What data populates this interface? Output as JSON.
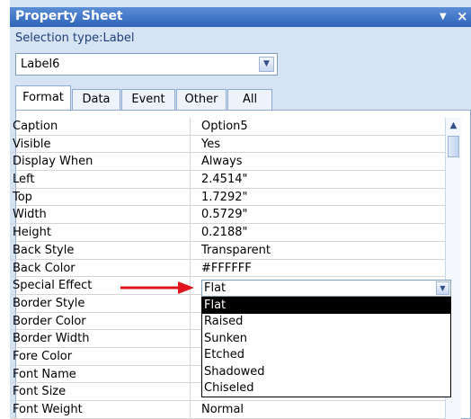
{
  "window": {
    "title": "Property Sheet",
    "menu_icon": "dropdown-arrow-icon",
    "close_icon": "close-icon"
  },
  "selection": {
    "type_label": "Selection type:Label",
    "selected_object": "Label6"
  },
  "tabs": [
    {
      "label": "Format",
      "active": true
    },
    {
      "label": "Data",
      "active": false
    },
    {
      "label": "Event",
      "active": false
    },
    {
      "label": "Other",
      "active": false
    },
    {
      "label": "All",
      "active": false
    }
  ],
  "properties": [
    {
      "name": "Caption",
      "value": "Option5"
    },
    {
      "name": "Visible",
      "value": "Yes"
    },
    {
      "name": "Display When",
      "value": "Always"
    },
    {
      "name": "Left",
      "value": "2.4514\""
    },
    {
      "name": "Top",
      "value": "1.7292\""
    },
    {
      "name": "Width",
      "value": "0.5729\""
    },
    {
      "name": "Height",
      "value": "0.2188\""
    },
    {
      "name": "Back Style",
      "value": "Transparent"
    },
    {
      "name": "Back Color",
      "value": "#FFFFFF"
    },
    {
      "name": "Special Effect",
      "value": ""
    },
    {
      "name": "Border Style",
      "value": ""
    },
    {
      "name": "Border Color",
      "value": ""
    },
    {
      "name": "Border Width",
      "value": ""
    },
    {
      "name": "Fore Color",
      "value": ""
    },
    {
      "name": "Font Name",
      "value": ""
    },
    {
      "name": "Font Size",
      "value": ""
    },
    {
      "name": "Font Weight",
      "value": "Normal"
    }
  ],
  "special_effect": {
    "current": "Flat",
    "options": [
      "Flat",
      "Raised",
      "Sunken",
      "Etched",
      "Shadowed",
      "Chiseled"
    ],
    "highlighted": "Flat"
  },
  "colors": {
    "accent_title": "#2f64b9",
    "arrow": "#e0141c",
    "panel": "#d6e3f3"
  }
}
